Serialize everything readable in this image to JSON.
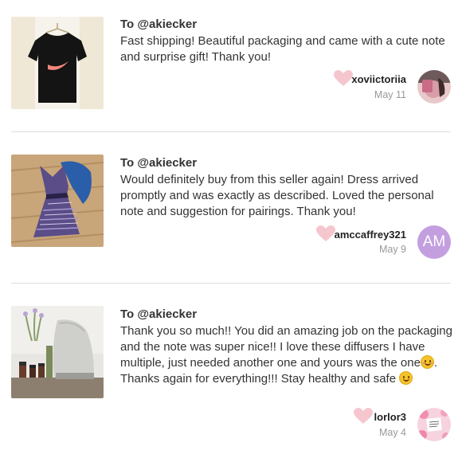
{
  "reviews": [
    {
      "to": "To @akiecker",
      "text": "Fast shipping! Beautiful packaging and came with a cute note and surprise gift! Thank you!",
      "user": "xoviictoriia",
      "date": "May 11",
      "image": "black-nike-tshirt",
      "avatar": "selfie-photo"
    },
    {
      "to": "To @akiecker",
      "text": "Would definitely buy from this seller again! Dress arrived promptly and was exactly as described. Loved the personal note and suggestion for pairings. Thank you!",
      "user": "amccaffrey321",
      "date": "May 9",
      "image": "purple-pattern-dress",
      "avatar_initials": "AM",
      "avatar_color": "#c39fe0"
    },
    {
      "to": "To @akiecker",
      "text_part1": "Thank you so much!! You did an amazing job on the packaging and the note was super nice!! I love these diffusers I have multiple, just needed another one and yours was the one",
      "text_part2": ". Thanks again for everything!!! Stay healthy and safe ",
      "user": "lorlor3",
      "date": "May 4",
      "image": "essential-oil-diffuser",
      "avatar": "floral-note-photo"
    }
  ],
  "colors": {
    "heart": "#f6c6cf",
    "divider": "#dddddd",
    "muted": "#999999"
  }
}
